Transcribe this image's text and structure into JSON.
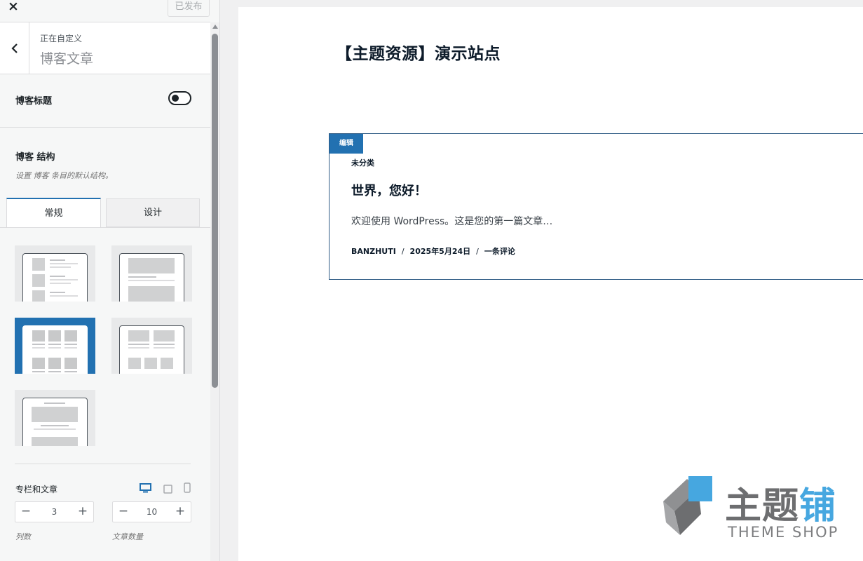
{
  "topbar": {
    "close_icon": "×",
    "publish_label": "已发布"
  },
  "section": {
    "customizing_label": "正在自定义",
    "title": "博客文章"
  },
  "blog_title_row": {
    "label": "博客标题",
    "toggle_on": false
  },
  "structure": {
    "title": "博客 结构",
    "description": "设置 博客 条目的默认结构。",
    "tabs": [
      "常规",
      "设计"
    ],
    "active_tab": "常规",
    "layouts": [
      "list",
      "single-full",
      "grid-3-cols",
      "grid-2-cols",
      "centered-single"
    ],
    "selected_layout": "grid-3-cols"
  },
  "columns_posts": {
    "label": "专栏和文章",
    "devices": [
      "desktop-icon",
      "tablet-icon",
      "mobile-icon"
    ],
    "active_device": "desktop-icon",
    "columns": {
      "value": "3",
      "caption": "列数"
    },
    "posts": {
      "value": "10",
      "caption": "文章数量"
    }
  },
  "preview": {
    "site_title": "【主题资源】演示站点",
    "edit_label": "编辑",
    "post": {
      "category": "未分类",
      "title": "世界，您好！",
      "excerpt": "欢迎使用 WordPress。这是您的第一篇文章…",
      "author": "BANZHUTI",
      "date": "2025年5月24日",
      "comments": "一条评论"
    }
  },
  "watermark": {
    "text_gray": "主题",
    "text_blue": "铺",
    "subtext": "THEME SHOP"
  },
  "colors": {
    "accent": "#2271b1",
    "text": "#1d2327",
    "watermark_blue": "#46a7e0"
  }
}
